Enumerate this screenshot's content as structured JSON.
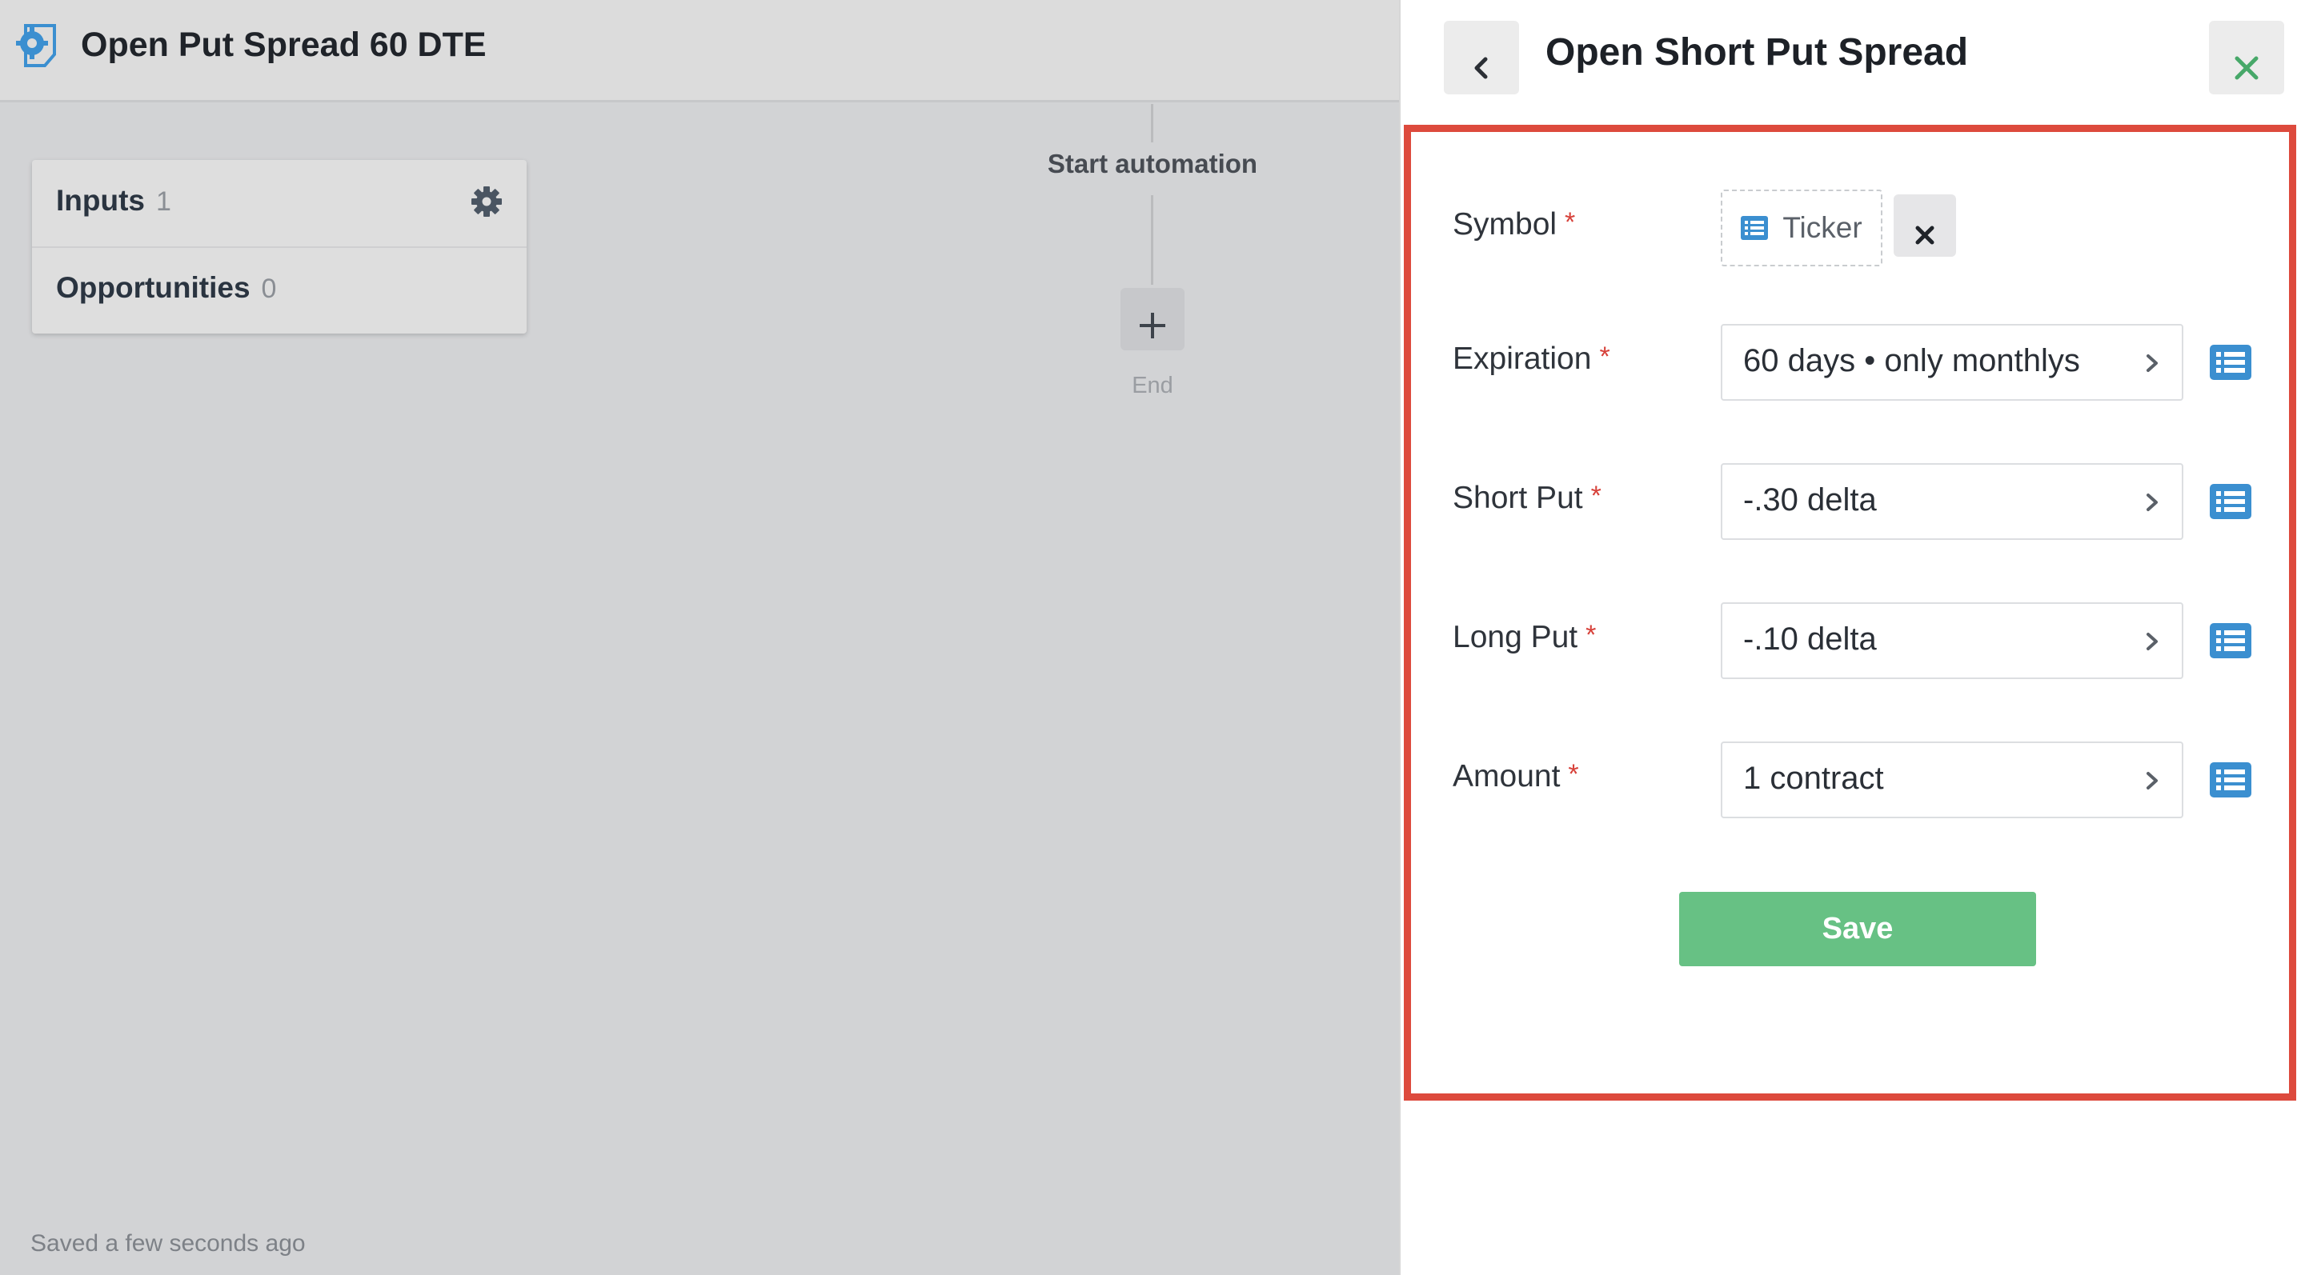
{
  "header": {
    "title": "Open Put Spread 60 DTE",
    "icon": "automation-gear-icon"
  },
  "sidebar_card": {
    "items": [
      {
        "label": "Inputs",
        "count": "1",
        "icon": "gear-icon"
      },
      {
        "label": "Opportunities",
        "count": "0"
      }
    ]
  },
  "flow": {
    "start_label": "Start automation",
    "add_icon": "plus-icon",
    "end_label": "End"
  },
  "status": {
    "saved_text": "Saved a few seconds ago"
  },
  "panel": {
    "title": "Open Short Put Spread",
    "back_icon": "chevron-left-icon",
    "close_icon": "close-icon",
    "highlight_color": "#dd4a3d",
    "required_marker": "*",
    "fields": {
      "symbol": {
        "label": "Symbol",
        "chip_label": "Ticker",
        "chip_icon": "list-icon",
        "clear_icon": "x-icon"
      },
      "expiration": {
        "label": "Expiration",
        "value": "60 days • only monthlys"
      },
      "short_put": {
        "label": "Short Put",
        "value": "-.30 delta"
      },
      "long_put": {
        "label": "Long Put",
        "value": "-.10 delta"
      },
      "amount": {
        "label": "Amount",
        "value": "1 contract"
      }
    },
    "save_label": "Save",
    "colors": {
      "accent_blue": "#3b8fd0",
      "save_green": "#67c184",
      "close_green": "#47a869"
    }
  }
}
